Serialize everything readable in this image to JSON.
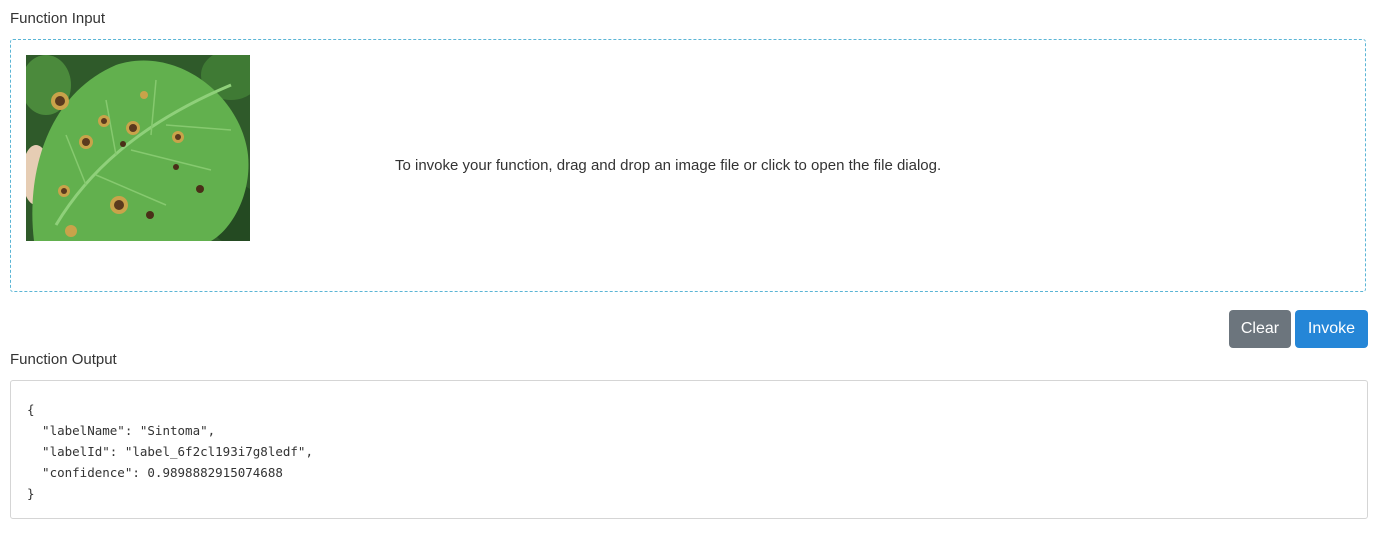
{
  "input": {
    "label": "Function Input",
    "drop_hint": "To invoke your function, drag and drop an image file or click to open the file dialog.",
    "image_alt": "soybean leaf with lesions"
  },
  "buttons": {
    "clear_label": "Clear",
    "invoke_label": "Invoke"
  },
  "output": {
    "label": "Function Output",
    "json_text": "{\n  \"labelName\": \"Sintoma\",\n  \"labelId\": \"label_6f2cl193i7g8ledf\",\n  \"confidence\": 0.9898882915074688\n}"
  },
  "colors": {
    "dropzone_border": "#5bb5d5",
    "clear_button": "#6c757d",
    "invoke_button": "#2586d7"
  }
}
